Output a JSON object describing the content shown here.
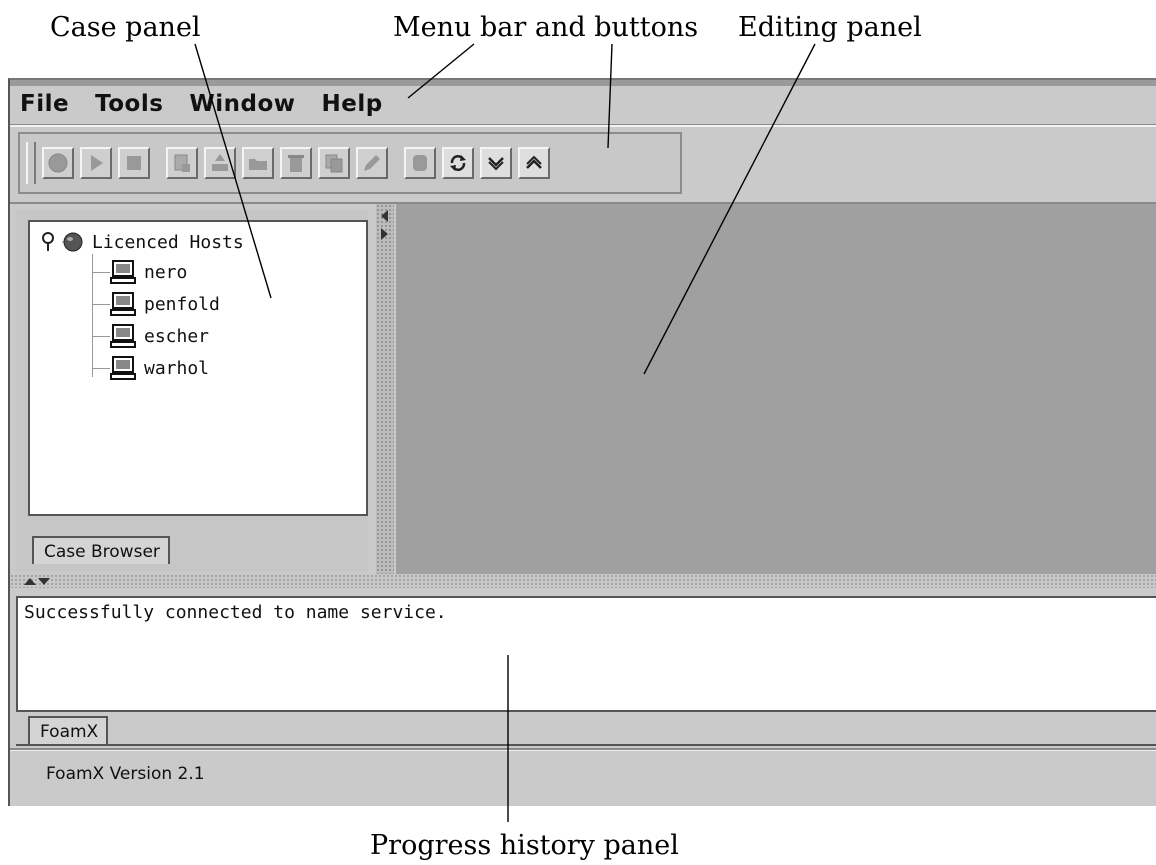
{
  "callouts": {
    "case_panel": "Case panel",
    "menu_bar": "Menu bar and buttons",
    "editing_panel": "Editing panel",
    "progress_panel": "Progress history panel"
  },
  "menubar": {
    "items": [
      "File",
      "Tools",
      "Window",
      "Help"
    ]
  },
  "toolbar": {
    "icons": [
      "record-icon",
      "play-icon",
      "stop-icon",
      "new-case-icon",
      "import-icon",
      "open-folder-icon",
      "delete-icon",
      "copy-icon",
      "edit-icon",
      "database-icon",
      "refresh-icon",
      "collapse-icon",
      "expand-icon"
    ]
  },
  "case_browser": {
    "root_label": "Licenced Hosts",
    "hosts": [
      "nero",
      "penfold",
      "escher",
      "warhol"
    ],
    "tab_label": "Case Browser"
  },
  "progress": {
    "message": "Successfully connected to name service.",
    "tab_label": "FoamX"
  },
  "status": {
    "text": "FoamX Version 2.1"
  },
  "colors": {
    "window_bg": "#cacaca",
    "editing_panel_bg": "#a0a0a0",
    "text_area_bg": "#ffffff"
  }
}
